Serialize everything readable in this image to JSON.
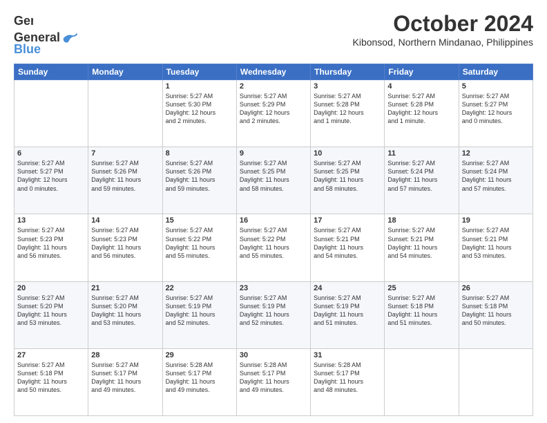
{
  "logo": {
    "line1": "General",
    "line2": "Blue"
  },
  "title": "October 2024",
  "location": "Kibonsod, Northern Mindanao, Philippines",
  "days_header": [
    "Sunday",
    "Monday",
    "Tuesday",
    "Wednesday",
    "Thursday",
    "Friday",
    "Saturday"
  ],
  "weeks": [
    [
      {
        "day": "",
        "info": ""
      },
      {
        "day": "",
        "info": ""
      },
      {
        "day": "1",
        "info": "Sunrise: 5:27 AM\nSunset: 5:30 PM\nDaylight: 12 hours\nand 2 minutes."
      },
      {
        "day": "2",
        "info": "Sunrise: 5:27 AM\nSunset: 5:29 PM\nDaylight: 12 hours\nand 2 minutes."
      },
      {
        "day": "3",
        "info": "Sunrise: 5:27 AM\nSunset: 5:28 PM\nDaylight: 12 hours\nand 1 minute."
      },
      {
        "day": "4",
        "info": "Sunrise: 5:27 AM\nSunset: 5:28 PM\nDaylight: 12 hours\nand 1 minute."
      },
      {
        "day": "5",
        "info": "Sunrise: 5:27 AM\nSunset: 5:27 PM\nDaylight: 12 hours\nand 0 minutes."
      }
    ],
    [
      {
        "day": "6",
        "info": "Sunrise: 5:27 AM\nSunset: 5:27 PM\nDaylight: 12 hours\nand 0 minutes."
      },
      {
        "day": "7",
        "info": "Sunrise: 5:27 AM\nSunset: 5:26 PM\nDaylight: 11 hours\nand 59 minutes."
      },
      {
        "day": "8",
        "info": "Sunrise: 5:27 AM\nSunset: 5:26 PM\nDaylight: 11 hours\nand 59 minutes."
      },
      {
        "day": "9",
        "info": "Sunrise: 5:27 AM\nSunset: 5:25 PM\nDaylight: 11 hours\nand 58 minutes."
      },
      {
        "day": "10",
        "info": "Sunrise: 5:27 AM\nSunset: 5:25 PM\nDaylight: 11 hours\nand 58 minutes."
      },
      {
        "day": "11",
        "info": "Sunrise: 5:27 AM\nSunset: 5:24 PM\nDaylight: 11 hours\nand 57 minutes."
      },
      {
        "day": "12",
        "info": "Sunrise: 5:27 AM\nSunset: 5:24 PM\nDaylight: 11 hours\nand 57 minutes."
      }
    ],
    [
      {
        "day": "13",
        "info": "Sunrise: 5:27 AM\nSunset: 5:23 PM\nDaylight: 11 hours\nand 56 minutes."
      },
      {
        "day": "14",
        "info": "Sunrise: 5:27 AM\nSunset: 5:23 PM\nDaylight: 11 hours\nand 56 minutes."
      },
      {
        "day": "15",
        "info": "Sunrise: 5:27 AM\nSunset: 5:22 PM\nDaylight: 11 hours\nand 55 minutes."
      },
      {
        "day": "16",
        "info": "Sunrise: 5:27 AM\nSunset: 5:22 PM\nDaylight: 11 hours\nand 55 minutes."
      },
      {
        "day": "17",
        "info": "Sunrise: 5:27 AM\nSunset: 5:21 PM\nDaylight: 11 hours\nand 54 minutes."
      },
      {
        "day": "18",
        "info": "Sunrise: 5:27 AM\nSunset: 5:21 PM\nDaylight: 11 hours\nand 54 minutes."
      },
      {
        "day": "19",
        "info": "Sunrise: 5:27 AM\nSunset: 5:21 PM\nDaylight: 11 hours\nand 53 minutes."
      }
    ],
    [
      {
        "day": "20",
        "info": "Sunrise: 5:27 AM\nSunset: 5:20 PM\nDaylight: 11 hours\nand 53 minutes."
      },
      {
        "day": "21",
        "info": "Sunrise: 5:27 AM\nSunset: 5:20 PM\nDaylight: 11 hours\nand 53 minutes."
      },
      {
        "day": "22",
        "info": "Sunrise: 5:27 AM\nSunset: 5:19 PM\nDaylight: 11 hours\nand 52 minutes."
      },
      {
        "day": "23",
        "info": "Sunrise: 5:27 AM\nSunset: 5:19 PM\nDaylight: 11 hours\nand 52 minutes."
      },
      {
        "day": "24",
        "info": "Sunrise: 5:27 AM\nSunset: 5:19 PM\nDaylight: 11 hours\nand 51 minutes."
      },
      {
        "day": "25",
        "info": "Sunrise: 5:27 AM\nSunset: 5:18 PM\nDaylight: 11 hours\nand 51 minutes."
      },
      {
        "day": "26",
        "info": "Sunrise: 5:27 AM\nSunset: 5:18 PM\nDaylight: 11 hours\nand 50 minutes."
      }
    ],
    [
      {
        "day": "27",
        "info": "Sunrise: 5:27 AM\nSunset: 5:18 PM\nDaylight: 11 hours\nand 50 minutes."
      },
      {
        "day": "28",
        "info": "Sunrise: 5:27 AM\nSunset: 5:17 PM\nDaylight: 11 hours\nand 49 minutes."
      },
      {
        "day": "29",
        "info": "Sunrise: 5:28 AM\nSunset: 5:17 PM\nDaylight: 11 hours\nand 49 minutes."
      },
      {
        "day": "30",
        "info": "Sunrise: 5:28 AM\nSunset: 5:17 PM\nDaylight: 11 hours\nand 49 minutes."
      },
      {
        "day": "31",
        "info": "Sunrise: 5:28 AM\nSunset: 5:17 PM\nDaylight: 11 hours\nand 48 minutes."
      },
      {
        "day": "",
        "info": ""
      },
      {
        "day": "",
        "info": ""
      }
    ]
  ]
}
